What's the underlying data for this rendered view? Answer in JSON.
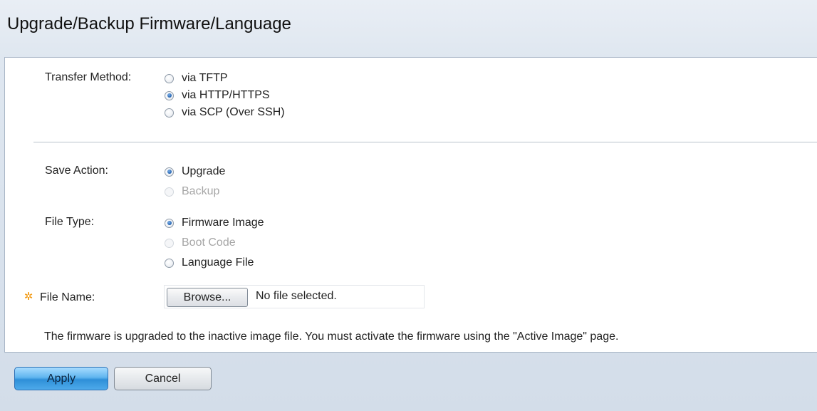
{
  "page": {
    "title": "Upgrade/Backup Firmware/Language"
  },
  "transfer_method": {
    "label": "Transfer Method:",
    "options": [
      {
        "label": "via TFTP",
        "checked": false,
        "enabled": true
      },
      {
        "label": "via HTTP/HTTPS",
        "checked": true,
        "enabled": true
      },
      {
        "label": "via SCP (Over SSH)",
        "checked": false,
        "enabled": true
      }
    ]
  },
  "save_action": {
    "label": "Save Action:",
    "options": [
      {
        "label": "Upgrade",
        "checked": true,
        "enabled": true
      },
      {
        "label": "Backup",
        "checked": false,
        "enabled": false
      }
    ]
  },
  "file_type": {
    "label": "File Type:",
    "options": [
      {
        "label": "Firmware Image",
        "checked": true,
        "enabled": true
      },
      {
        "label": "Boot Code",
        "checked": false,
        "enabled": false
      },
      {
        "label": "Language File",
        "checked": false,
        "enabled": true
      }
    ]
  },
  "file_name": {
    "label": "File Name:",
    "browse_label": "Browse...",
    "status": "No file selected.",
    "required_icon": "required-asterisk-icon"
  },
  "note": "The firmware is upgraded to the inactive image file. You must activate the firmware using the \"Active Image\" page.",
  "actions": {
    "apply_label": "Apply",
    "cancel_label": "Cancel"
  },
  "colors": {
    "accent": "#2e8fd8",
    "required": "#f29a14",
    "disabled_text": "#a6a6a6"
  }
}
